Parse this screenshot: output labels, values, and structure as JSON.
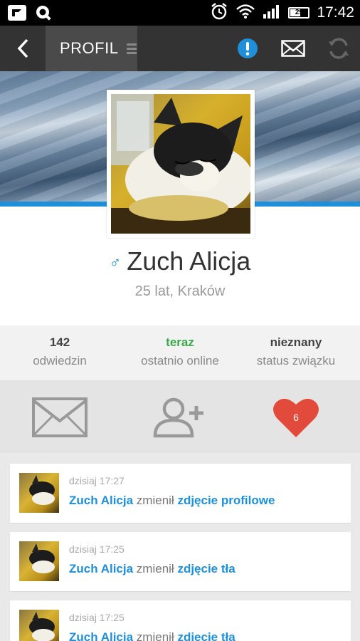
{
  "statusbar": {
    "time": "17:42",
    "battery": "29"
  },
  "actionbar": {
    "title": "PROFIL"
  },
  "profile": {
    "name": "Zuch Alicja",
    "gender_symbol": "♂",
    "subline": "25 lat, Kraków"
  },
  "stats": [
    {
      "value": "142",
      "label": "odwiedzin",
      "color": "#444444"
    },
    {
      "value": "teraz",
      "label": "ostatnio online",
      "color": "#3aa64a"
    },
    {
      "value": "nieznany",
      "label": "status związku",
      "color": "#444444"
    }
  ],
  "actions": {
    "likes_count": "6"
  },
  "feed": [
    {
      "time": "dzisiaj 17:27",
      "user": "Zuch Alicja",
      "verb": "zmienił",
      "object": "zdjęcie profilowe"
    },
    {
      "time": "dzisiaj 17:25",
      "user": "Zuch Alicja",
      "verb": "zmienił",
      "object": "zdjęcie tła"
    },
    {
      "time": "dzisiaj 17:25",
      "user": "Zuch Alicja",
      "verb": "zmienił",
      "object": "zdjęcie tła"
    }
  ],
  "colors": {
    "accent": "#1e8fd8",
    "online": "#3aa64a",
    "heart": "#e24b3b",
    "actionbar": "#333333"
  }
}
